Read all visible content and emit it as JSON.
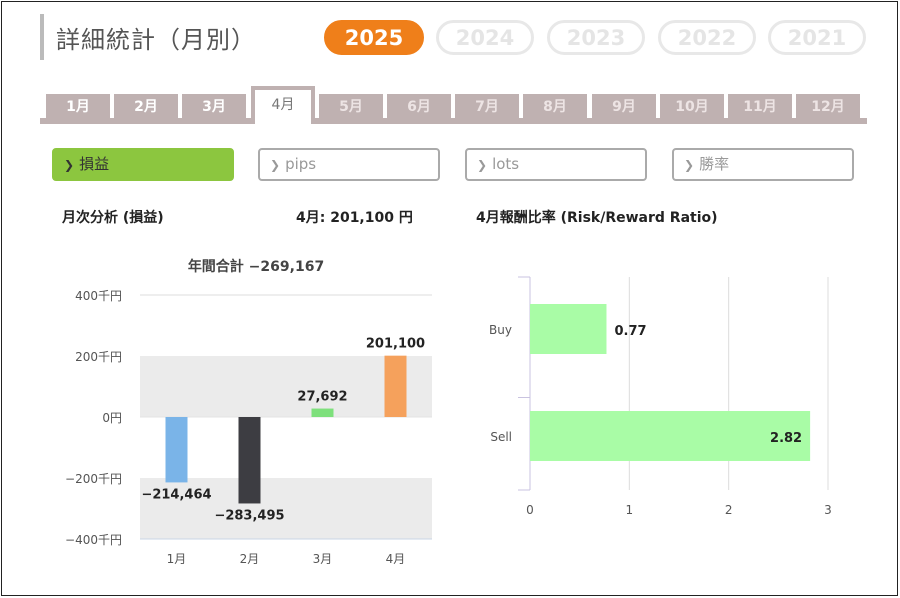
{
  "page": {
    "title": "詳細統計（月別）",
    "years": [
      {
        "label": "2025",
        "active": true
      },
      {
        "label": "2024",
        "active": false
      },
      {
        "label": "2023",
        "active": false
      },
      {
        "label": "2022",
        "active": false
      },
      {
        "label": "2021",
        "active": false
      }
    ],
    "months": [
      "1月",
      "2月",
      "3月",
      "4月",
      "5月",
      "6月",
      "7月",
      "8月",
      "9月",
      "10月",
      "11月",
      "12月"
    ],
    "active_month_index": 3,
    "enabled_month_count": 4,
    "metrics": [
      {
        "label": "損益",
        "active": true
      },
      {
        "label": "pips",
        "active": false
      },
      {
        "label": "lots",
        "active": false
      },
      {
        "label": "勝率",
        "active": false
      }
    ],
    "left_heading": "月次分析 (損益)",
    "month_value_label": "4月: 201,100 円",
    "right_heading": "4月報酬比率 (Risk/Reward Ratio)",
    "colors": {
      "accent": "#ef7f1a",
      "metric_active": "#8cc63f",
      "tab": "#bfb1b1"
    }
  },
  "chart_data": [
    {
      "type": "bar",
      "title": "年間合計 −269,167",
      "categories": [
        "1月",
        "2月",
        "3月",
        "4月"
      ],
      "values": [
        -214464,
        -283495,
        27692,
        201100
      ],
      "value_labels": [
        "−214,464",
        "−283,495",
        "27,692",
        "201,100"
      ],
      "bar_colors": [
        "#7ab4e8",
        "#3d3d42",
        "#7ee07c",
        "#f5a15c"
      ],
      "yticks": [
        400,
        200,
        0,
        -200,
        -400
      ],
      "ytick_labels": [
        "400千円",
        "200千円",
        "0円",
        "−200千円",
        "−400千円"
      ],
      "ylim": [
        -400,
        400
      ],
      "unit": "千円"
    },
    {
      "type": "bar",
      "orientation": "horizontal",
      "categories": [
        "Buy",
        "Sell"
      ],
      "values": [
        0.77,
        2.82
      ],
      "value_labels": [
        "0.77",
        "2.82"
      ],
      "bar_color": "#a9fca6",
      "xticks": [
        0,
        1,
        2,
        3
      ],
      "xlim": [
        0,
        3
      ]
    }
  ]
}
